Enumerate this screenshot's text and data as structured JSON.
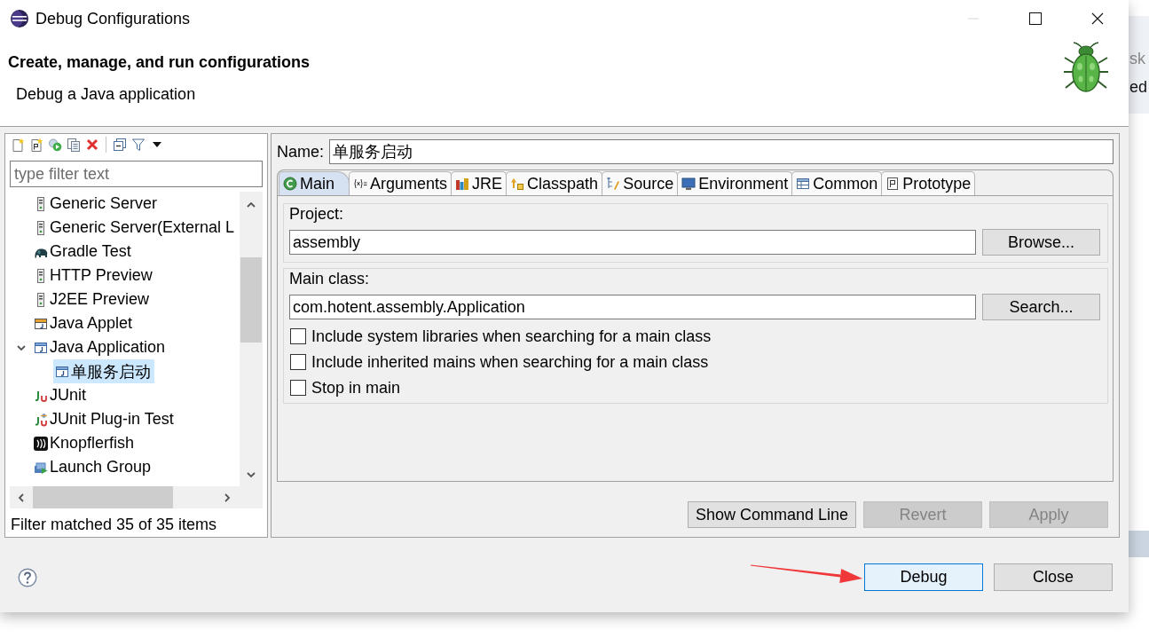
{
  "window": {
    "title": "Debug Configurations"
  },
  "header": {
    "title": "Create, manage, and run configurations",
    "message": "Debug a Java application"
  },
  "sidebar": {
    "filter": {
      "placeholder": "type filter text"
    },
    "tree": [
      {
        "label": "Generic Server",
        "kind": "server",
        "selected": false
      },
      {
        "label": "Generic Server(External L",
        "kind": "server",
        "selected": false
      },
      {
        "label": "Gradle Test",
        "kind": "gradle",
        "selected": false
      },
      {
        "label": "HTTP Preview",
        "kind": "server",
        "selected": false
      },
      {
        "label": "J2EE Preview",
        "kind": "server",
        "selected": false
      },
      {
        "label": "Java Applet",
        "kind": "applet",
        "selected": false
      },
      {
        "label": "Java Application",
        "kind": "java-app",
        "selected": false,
        "expanded": true,
        "children": [
          {
            "label": "单服务启动",
            "kind": "java-app",
            "selected": true
          }
        ]
      },
      {
        "label": "JUnit",
        "kind": "junit",
        "selected": false
      },
      {
        "label": "JUnit Plug-in Test",
        "kind": "junit-plugin",
        "selected": false
      },
      {
        "label": "Knopflerfish",
        "kind": "knopflerfish",
        "selected": false
      },
      {
        "label": "Launch Group",
        "kind": "launch-group",
        "selected": false
      }
    ],
    "status": "Filter matched 35 of 35 items"
  },
  "editor": {
    "name_label": "Name:",
    "name": "单服务启动",
    "tabs": [
      {
        "label": "Main",
        "kind": "main",
        "selected": true
      },
      {
        "label": "Arguments",
        "kind": "arguments",
        "selected": false
      },
      {
        "label": "JRE",
        "kind": "jre",
        "selected": false
      },
      {
        "label": "Classpath",
        "kind": "classpath",
        "selected": false
      },
      {
        "label": "Source",
        "kind": "source",
        "selected": false
      },
      {
        "label": "Environment",
        "kind": "environment",
        "selected": false
      },
      {
        "label": "Common",
        "kind": "common",
        "selected": false
      },
      {
        "label": "Prototype",
        "kind": "prototype",
        "selected": false
      }
    ],
    "project": {
      "label": "Project:",
      "value": "assembly",
      "button": "Browse..."
    },
    "main_class": {
      "label": "Main class:",
      "value": "com.hotent.assembly.Application",
      "button": "Search..."
    },
    "options": [
      {
        "label": "Include system libraries when searching for a main class",
        "checked": false
      },
      {
        "label": "Include inherited mains when searching for a main class",
        "checked": false
      },
      {
        "label": "Stop in main",
        "checked": false
      }
    ],
    "buttons": [
      {
        "label": "Show Command Line",
        "disabled": false
      },
      {
        "label": "Revert",
        "disabled": true
      },
      {
        "label": "Apply",
        "disabled": true
      }
    ]
  },
  "footer": {
    "buttons": [
      {
        "label": "Debug",
        "default": true
      },
      {
        "label": "Close",
        "default": false
      }
    ]
  },
  "background": {
    "texts": [
      "sk",
      "ed"
    ]
  }
}
